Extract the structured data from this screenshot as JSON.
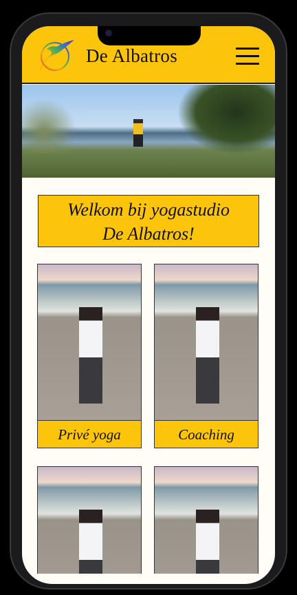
{
  "header": {
    "title": "De Albatros",
    "logo_icon": "albatross-logo",
    "menu_icon": "hamburger-menu-icon"
  },
  "welcome": {
    "line1": "Welkom bij yogastudio",
    "line2": "De Albatros!"
  },
  "cards": [
    {
      "label": "Privé yoga"
    },
    {
      "label": "Coaching"
    },
    {
      "label": ""
    },
    {
      "label": ""
    }
  ],
  "colors": {
    "accent": "#fdc40c",
    "background": "#fffdf5"
  }
}
